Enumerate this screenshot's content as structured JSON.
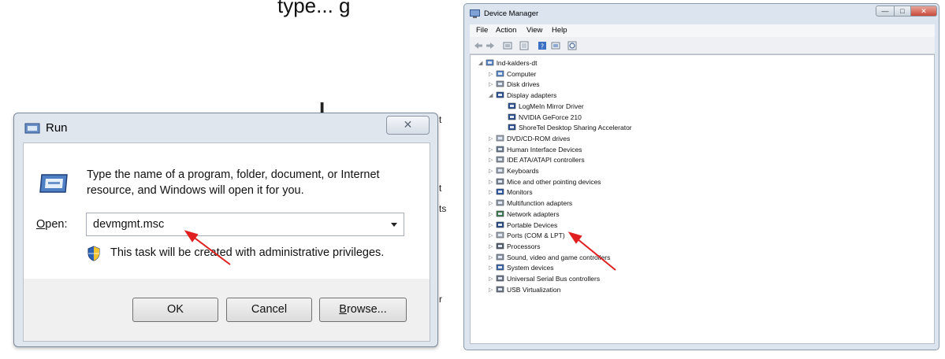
{
  "background": {
    "top_fragment": "type... g",
    "mid_left_fragments": [
      "L",
      "t",
      "t",
      "ts",
      "r"
    ]
  },
  "run_dialog": {
    "title": "Run",
    "close_glyph": "✕",
    "description": "Type the name of a program, folder, document, or Internet resource, and Windows will open it for you.",
    "open_label_prefix": "O",
    "open_label_rest": "pen:",
    "input_value": "devmgmt.msc",
    "admin_note": "This task will be created with administrative privileges.",
    "buttons": {
      "ok": "OK",
      "cancel": "Cancel",
      "browse_prefix": "B",
      "browse_rest": "rowse..."
    },
    "icons": [
      "run-app-icon",
      "shield-icon",
      "dropdown-arrow-icon",
      "close-icon"
    ],
    "arrow_color": "#e02020"
  },
  "device_manager": {
    "title": "Device Manager",
    "caption_buttons": {
      "minimize": "—",
      "maximize": "□",
      "close": "✕"
    },
    "menu": [
      "File",
      "Action",
      "View",
      "Help"
    ],
    "toolbar_icons": [
      "back-arrow-icon",
      "forward-arrow-icon",
      "properties-icon",
      "update-driver-icon",
      "help-icon",
      "scan-hardware-icon",
      "disable-icon"
    ],
    "tree": [
      {
        "level": 0,
        "expander": "◢",
        "icon": "computer-icon",
        "label": "lnd-kalders-dt"
      },
      {
        "level": 1,
        "expander": "▷",
        "icon": "computer-icon",
        "label": "Computer"
      },
      {
        "level": 1,
        "expander": "▷",
        "icon": "disk-drive-icon",
        "label": "Disk drives"
      },
      {
        "level": 1,
        "expander": "◢",
        "icon": "display-adapter-icon",
        "label": "Display adapters"
      },
      {
        "level": 2,
        "expander": "",
        "icon": "display-adapter-icon",
        "label": "LogMeIn Mirror Driver"
      },
      {
        "level": 2,
        "expander": "",
        "icon": "display-adapter-icon",
        "label": "NVIDIA GeForce 210"
      },
      {
        "level": 2,
        "expander": "",
        "icon": "display-adapter-icon",
        "label": "ShoreTel Desktop Sharing Accelerator"
      },
      {
        "level": 1,
        "expander": "▷",
        "icon": "dvd-drive-icon",
        "label": "DVD/CD-ROM drives"
      },
      {
        "level": 1,
        "expander": "▷",
        "icon": "hid-icon",
        "label": "Human Interface Devices"
      },
      {
        "level": 1,
        "expander": "▷",
        "icon": "ide-controller-icon",
        "label": "IDE ATA/ATAPI controllers"
      },
      {
        "level": 1,
        "expander": "▷",
        "icon": "keyboard-icon",
        "label": "Keyboards"
      },
      {
        "level": 1,
        "expander": "▷",
        "icon": "mouse-icon",
        "label": "Mice and other pointing devices"
      },
      {
        "level": 1,
        "expander": "▷",
        "icon": "monitor-icon",
        "label": "Monitors"
      },
      {
        "level": 1,
        "expander": "▷",
        "icon": "multifunction-icon",
        "label": "Multifunction adapters"
      },
      {
        "level": 1,
        "expander": "▷",
        "icon": "network-adapter-icon",
        "label": "Network adapters"
      },
      {
        "level": 1,
        "expander": "▷",
        "icon": "portable-device-icon",
        "label": "Portable Devices"
      },
      {
        "level": 1,
        "expander": "▷",
        "icon": "port-icon",
        "label": "Ports (COM & LPT)"
      },
      {
        "level": 1,
        "expander": "▷",
        "icon": "processor-icon",
        "label": "Processors"
      },
      {
        "level": 1,
        "expander": "▷",
        "icon": "speaker-icon",
        "label": "Sound, video and game controllers"
      },
      {
        "level": 1,
        "expander": "▷",
        "icon": "system-device-icon",
        "label": "System devices"
      },
      {
        "level": 1,
        "expander": "▷",
        "icon": "usb-icon",
        "label": "Universal Serial Bus controllers"
      },
      {
        "level": 1,
        "expander": "▷",
        "icon": "usb-icon",
        "label": "USB Virtualization"
      }
    ]
  }
}
